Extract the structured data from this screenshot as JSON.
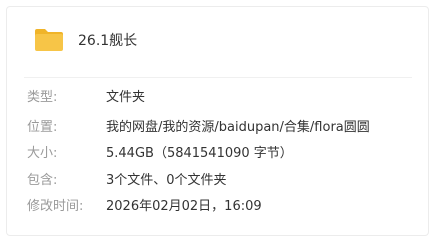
{
  "file": {
    "name": "26.1舰长"
  },
  "properties": {
    "type": {
      "label": "类型:",
      "value": "文件夹"
    },
    "location": {
      "label": "位置:",
      "value": "我的网盘/我的资源/baidupan/合集/flora圆圆"
    },
    "size": {
      "label": "大小:",
      "value": "5.44GB（5841541090 字节）"
    },
    "contains": {
      "label": "包含:",
      "value": "3个文件、0个文件夹"
    },
    "modified": {
      "label": "修改时间:",
      "value": "2026年02月02日，16:09"
    }
  },
  "colors": {
    "folder": "#f7c547",
    "folder_back": "#f0b429",
    "label": "#9a9a9a",
    "value": "#333333"
  },
  "icons": {
    "folder": "folder-icon"
  }
}
